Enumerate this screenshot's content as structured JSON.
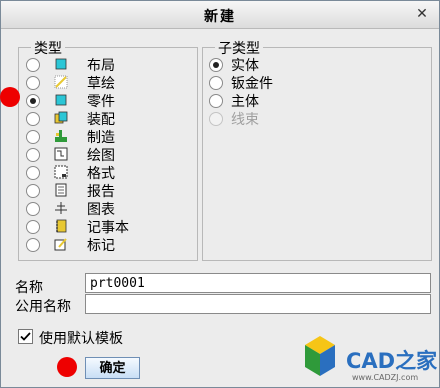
{
  "dialog": {
    "title": "新建",
    "close_symbol": "✕"
  },
  "type_group": {
    "legend": "类型",
    "items": [
      {
        "label": "布局",
        "icon": "layout-icon",
        "checked": false
      },
      {
        "label": "草绘",
        "icon": "sketch-icon",
        "checked": false
      },
      {
        "label": "零件",
        "icon": "part-icon",
        "checked": true
      },
      {
        "label": "装配",
        "icon": "assembly-icon",
        "checked": false
      },
      {
        "label": "制造",
        "icon": "manufacturing-icon",
        "checked": false
      },
      {
        "label": "绘图",
        "icon": "drawing-icon",
        "checked": false
      },
      {
        "label": "格式",
        "icon": "format-icon",
        "checked": false
      },
      {
        "label": "报告",
        "icon": "report-icon",
        "checked": false
      },
      {
        "label": "图表",
        "icon": "diagram-icon",
        "checked": false
      },
      {
        "label": "记事本",
        "icon": "notebook-icon",
        "checked": false
      },
      {
        "label": "标记",
        "icon": "markup-icon",
        "checked": false
      }
    ]
  },
  "subtype_group": {
    "legend": "子类型",
    "items": [
      {
        "label": "实体",
        "checked": true,
        "disabled": false
      },
      {
        "label": "钣金件",
        "checked": false,
        "disabled": false
      },
      {
        "label": "主体",
        "checked": false,
        "disabled": false
      },
      {
        "label": "线束",
        "checked": false,
        "disabled": true
      }
    ]
  },
  "name_field": {
    "label": "名称",
    "value": "prt0001"
  },
  "common_name_field": {
    "label": "公用名称",
    "value": ""
  },
  "default_template": {
    "label": "使用默认模板",
    "checked": true
  },
  "ok_button": {
    "label": "确定"
  },
  "watermark": {
    "text": "CAD之家",
    "url": "www.CADZJ.com"
  },
  "colors": {
    "annotation_dot": "#ee0000",
    "icon_cyan": "#2bc6d6",
    "icon_yellow": "#e8c832",
    "icon_green": "#2f9a3a",
    "button_border": "#6f8fb5"
  }
}
